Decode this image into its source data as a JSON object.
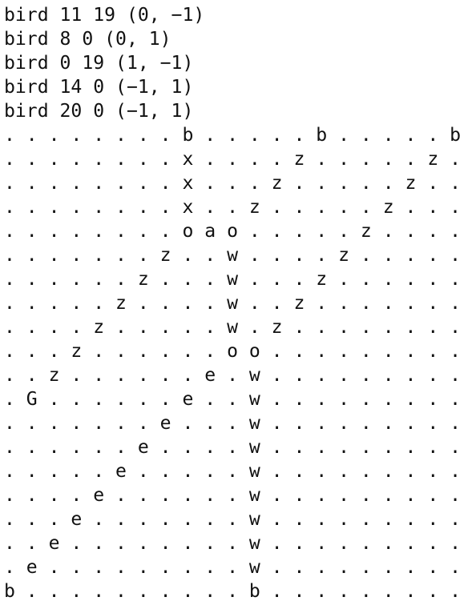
{
  "terminal": {
    "header_lines": [
      "bird 11 19 (0, −1)",
      "bird 8 0 (0, 1)",
      "bird 0 19 (1, −1)",
      "bird 14 0 (−1, 1)",
      "bird 20 0 (−1, 1)"
    ],
    "grid_rows": [
      ". . . . . . . . b . . . . . b . . . . . b",
      ". . . . . . . . x . . . . z . . . . . z .",
      ". . . . . . . . x . . . z . . . . . z . .",
      ". . . . . . . . x . . z . . . . . z . . .",
      ". . . . . . . . o a o . . . . . z . . . .",
      ". . . . . . . z . . w . . . . z . . . . .",
      ". . . . . . z . . . w . . . z . . . . . .",
      ". . . . . z . . . . w . . z . . . . . . .",
      ". . . . z . . . . . w . z . . . . . . . .",
      ". . . z . . . . . . o o . . . . . . . . .",
      ". . z . . . . . . e . w . . . . . . . . .",
      ". G . . . . . . e . . w . . . . . . . . .",
      ". . . . . . . e . . . w . . . . . . . . .",
      ". . . . . . e . . . . w . . . . . . . . .",
      ". . . . . e . . . . . w . . . . . . . . .",
      ". . . . e . . . . . . w . . . . . . . . .",
      ". . . e . . . . . . . w . . . . . . . . .",
      ". . e . . . . . . . . w . . . . . . . . .",
      ". e . . . . . . . . . w . . . . . . . . .",
      "b . . . . . . . . . . b . . . . . . . . ."
    ]
  }
}
